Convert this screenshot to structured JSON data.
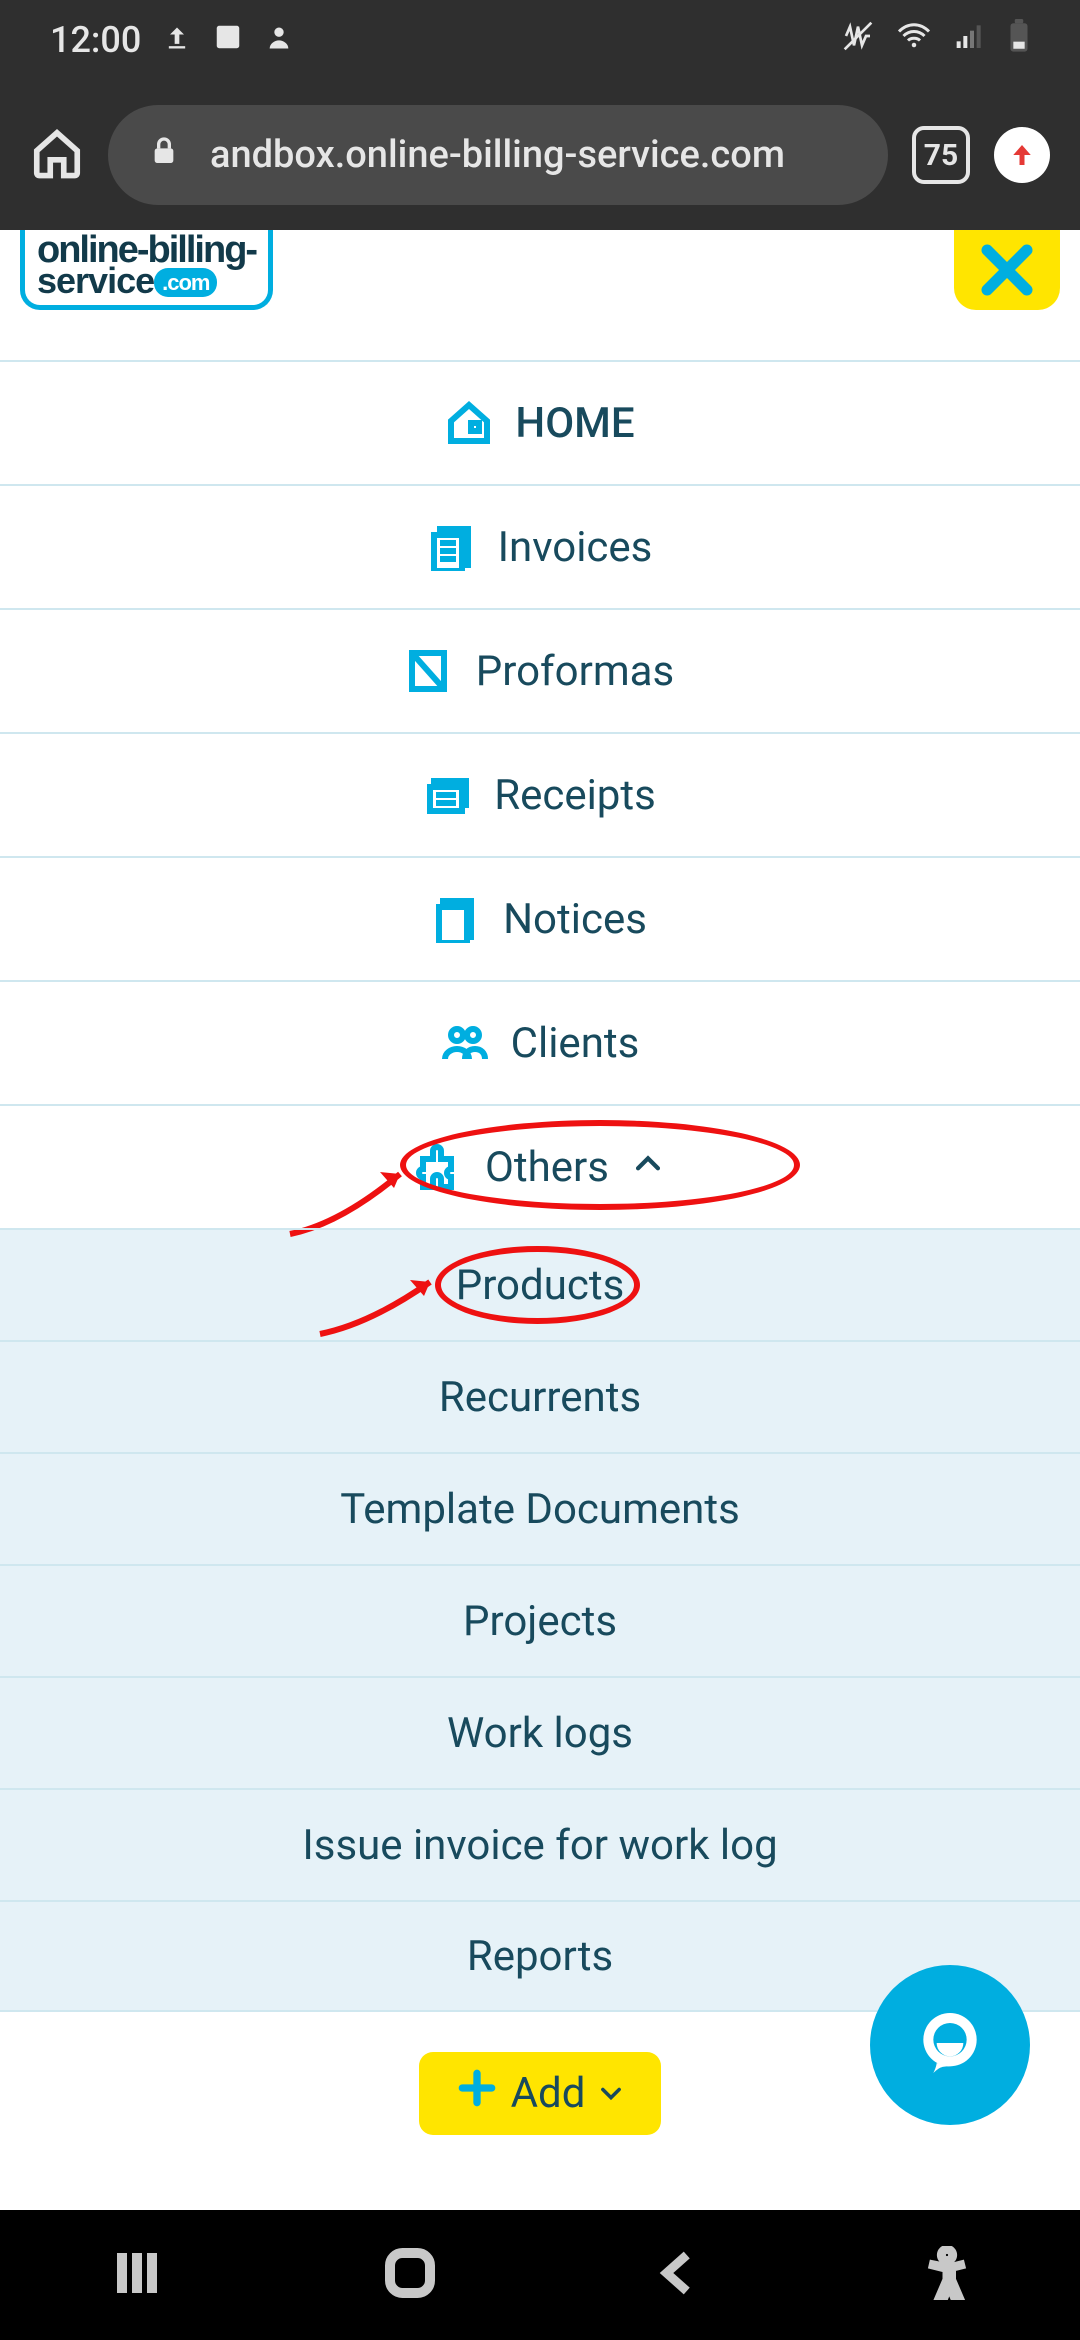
{
  "statusbar": {
    "time": "12:00"
  },
  "browser": {
    "url": "andbox.online-billing-service.com",
    "tab_count": "75"
  },
  "logo": {
    "line1": "online-billing-",
    "line2": "service",
    "dotcom": ".com"
  },
  "nav": {
    "items": [
      {
        "label": "HOME",
        "icon": "home"
      },
      {
        "label": "Invoices",
        "icon": "invoices"
      },
      {
        "label": "Proformas",
        "icon": "proformas"
      },
      {
        "label": "Receipts",
        "icon": "receipts"
      },
      {
        "label": "Notices",
        "icon": "notices"
      },
      {
        "label": "Clients",
        "icon": "clients"
      },
      {
        "label": "Others",
        "icon": "puzzle",
        "expanded": true
      }
    ],
    "others_submenu": [
      {
        "label": "Products"
      },
      {
        "label": "Recurrents"
      },
      {
        "label": "Template Documents"
      },
      {
        "label": "Projects"
      },
      {
        "label": "Work logs"
      },
      {
        "label": "Issue invoice for work log"
      },
      {
        "label": "Reports"
      }
    ]
  },
  "add_button": {
    "label": "Add"
  },
  "annotations": {
    "highlight_1": "Others",
    "highlight_2": "Products"
  }
}
